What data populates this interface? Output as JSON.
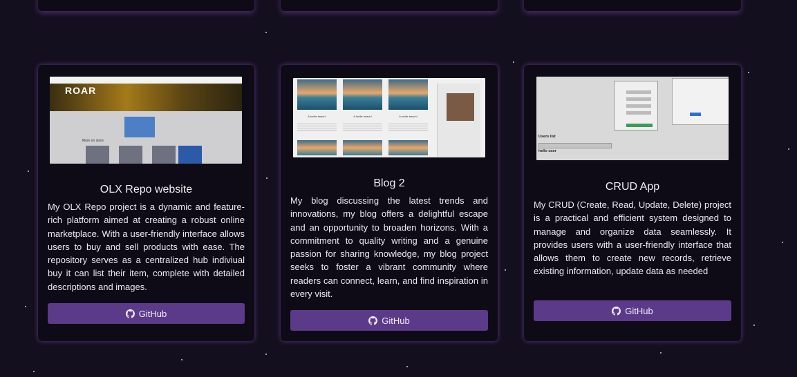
{
  "projects": [
    {
      "title": "OLX Repo website",
      "description": "My OLX Repo project is a dynamic and feature-rich platform aimed at creating a robust online marketplace. With a user-friendly interface allows users to buy and sell products with ease. The repository serves as a centralized hub indiviual buy it can list their item, complete with detailed descriptions and images.",
      "button_label": "GitHub",
      "thumbnail": {
        "banner_text": "ROAR",
        "section_text": "More on store"
      }
    },
    {
      "title": "Blog 2",
      "description": "My blog discussing the latest trends and innovations, my blog offers a delightful escape and an opportunity to broaden horizons. With a commitment to quality writing and a genuine passion for sharing knowledge, my blog project seeks to foster a vibrant community where readers can connect, learn, and find inspiration in every visit.",
      "button_label": "GitHub",
      "thumbnail": {
        "post_title": "A tortile beach!"
      }
    },
    {
      "title": "CRUD App",
      "description": "My CRUD (Create, Read, Update, Delete) project is a practical and efficient system designed to manage and organize data seamlessly. It provides users with a user-friendly interface that allows them to create new records, retrieve existing information, update data as needed",
      "button_label": "GitHub",
      "thumbnail": {
        "list_heading": "Users list",
        "greeting": "hello user"
      }
    }
  ],
  "icons": {
    "button_icon": "github-icon"
  },
  "colors": {
    "background": "#140f1f",
    "card": "#0e0b16",
    "accent": "#5c3a8a",
    "glow": "#7846aa"
  }
}
